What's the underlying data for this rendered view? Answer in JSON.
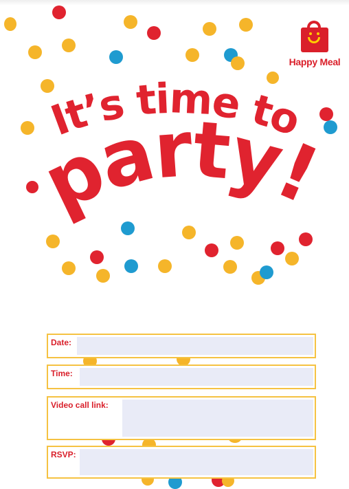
{
  "logo": {
    "text": "Happy Meal",
    "icon": "happy-meal-box-icon"
  },
  "headline": {
    "line1": "It’s time to",
    "line2": "party!"
  },
  "colors": {
    "red": "#e0232f",
    "yellow": "#f5b52a",
    "blue": "#1f9bd0",
    "field_border": "#f5c242",
    "field_fill": "#e9ebf7"
  },
  "form": {
    "date_label": "Date:",
    "time_label": "Time:",
    "video_label": "Video call link:",
    "rsvp_label": "RSVP:",
    "date_value": "",
    "time_value": "",
    "video_value": "",
    "rsvp_value": ""
  }
}
